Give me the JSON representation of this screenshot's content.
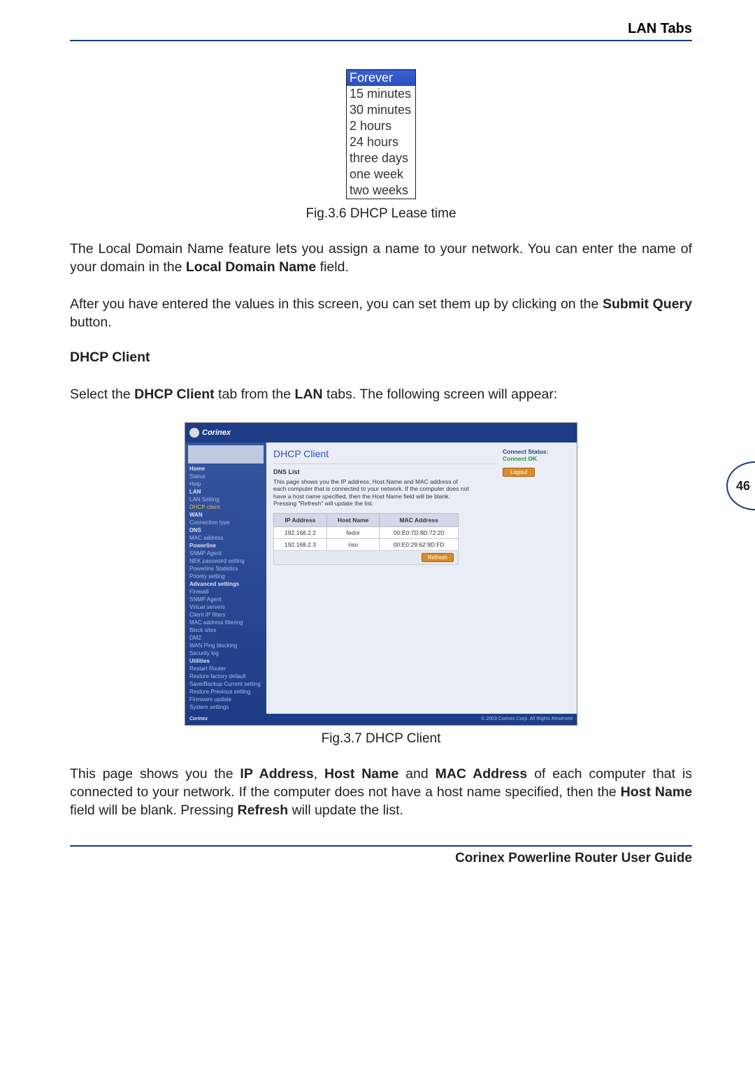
{
  "header": {
    "title": "LAN Tabs"
  },
  "leaseTimes": [
    "Forever",
    "15 minutes",
    "30 minutes",
    "2 hours",
    "24 hours",
    "three days",
    "one week",
    "two weeks"
  ],
  "captions": {
    "fig36": "Fig.3.6 DHCP Lease time",
    "fig37": "Fig.3.7 DHCP Client"
  },
  "paragraphs": {
    "p1a": "The Local Domain Name feature lets you assign a name to your network. You can enter the name of your domain in the ",
    "p1b": "Local Domain Name",
    "p1c": " field.",
    "p2a": "After you have entered the values in this screen, you can set them up by clicking on the ",
    "p2b": "Submit Query",
    "p2c": " button.",
    "head": "DHCP Client",
    "p3a": "Select the ",
    "p3b": "DHCP Client",
    "p3c": " tab from the ",
    "p3d": "LAN",
    "p3e": " tabs. The following screen will appear:",
    "p4a": "This page shows you the ",
    "p4b": "IP Address",
    "p4c": ", ",
    "p4d": "Host Name",
    "p4e": " and ",
    "p4f": "MAC Address",
    "p4g": " of each computer that is connected to your network. If the computer does not have a host name specified, then the ",
    "p4h": "Host Name",
    "p4i": " field will be blank. Pressing ",
    "p4j": "Refresh",
    "p4k": " will update the list."
  },
  "screenshot": {
    "brand": "Corinex",
    "title": "DHCP Client",
    "section": "DNS List",
    "desc": "This page shows you the IP address, Host Name and MAC address of each computer that is connected to your network. If the computer does not have a host name specified, then the Host Name field will be blank. Pressing \"Refresh\" will update the list.",
    "cols": {
      "ip": "IP Address",
      "host": "Host Name",
      "mac": "MAC Address"
    },
    "rows": [
      {
        "ip": "192.168.2.2",
        "host": "fedor",
        "mac": "00:E0:7D:8D:72:20"
      },
      {
        "ip": "192.168.2.3",
        "host": "riso",
        "mac": "00:E0:29:62:9D:FD"
      }
    ],
    "refresh": "Refresh",
    "status": {
      "label": "Connect Status:",
      "value": "Connect OK"
    },
    "logout": "Logout",
    "copyright": "© 2003 Corinex Corp. All Rights Reserved",
    "nav": {
      "home": "Home",
      "status": "Status",
      "help": "Help",
      "lan": "LAN",
      "lan_setting": "LAN Setting",
      "dhcp_client": "DHCP client",
      "wan": "WAN",
      "conn_type": "Connection type",
      "dns": "DNS",
      "mac_addr": "MAC address",
      "powerline": "Powerline",
      "snmp_agent": "SNMP Agent",
      "nek_pw": "NEK password setting",
      "pl_stats": "Powerline Statistics",
      "priority": "Priority setting",
      "advanced": "Advanced settings",
      "firewall": "Firewall",
      "snmp_agent2": "SNMP Agent",
      "virtual": "Virtual servers",
      "client_ip": "Client IP filters",
      "mac_filter": "MAC address filtering",
      "block_sites": "Block sites",
      "dmz": "DMZ",
      "wan_ping": "WAN Ping blocking",
      "sec_log": "Security log",
      "utilities": "Utilities",
      "restart": "Restart Router",
      "restore_factory": "Restore factory default",
      "save_backup": "Save/Backup Current setting",
      "restore_prev": "Restore Previous setting",
      "firmware": "Firmware update",
      "sys_settings": "System settings"
    }
  },
  "pageNumber": "46",
  "footer": "Corinex Powerline Router User Guide"
}
